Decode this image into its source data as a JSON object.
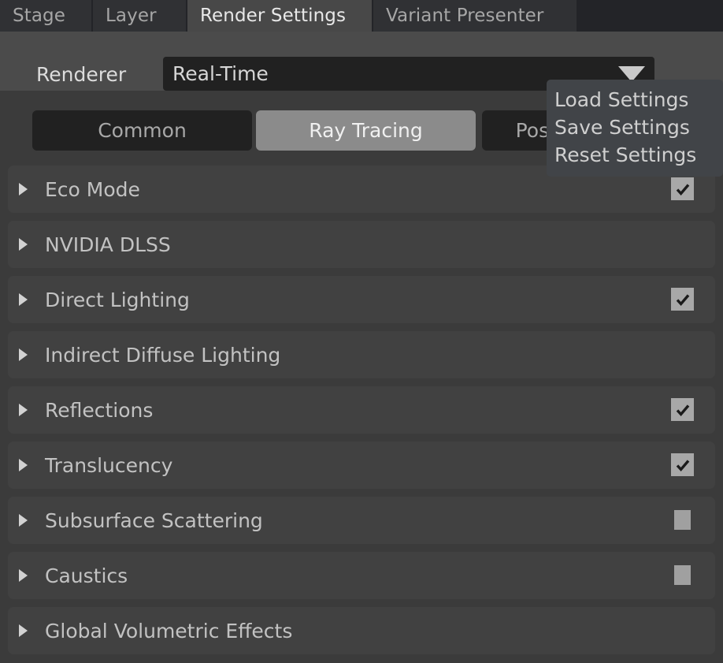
{
  "tabs": [
    {
      "label": "Stage",
      "active": false
    },
    {
      "label": "Layer",
      "active": false
    },
    {
      "label": "Render Settings",
      "active": true
    },
    {
      "label": "Variant Presenter",
      "active": false
    }
  ],
  "header": {
    "renderer_label": "Renderer",
    "renderer_value": "Real-Time",
    "renderer_placeholder": "Real-Time",
    "dropdown_icon": "chevron-down-icon",
    "menu_icon": "hamburger-menu-icon"
  },
  "subtabs": [
    {
      "label": "Common",
      "selected": false
    },
    {
      "label": "Ray Tracing",
      "selected": true
    },
    {
      "label": "Post Processing",
      "selected": false
    }
  ],
  "context_menu": {
    "visible": true,
    "items": [
      {
        "label": "Load Settings"
      },
      {
        "label": "Save Settings"
      },
      {
        "label": "Reset Settings"
      }
    ]
  },
  "rows": [
    {
      "label": "Eco Mode",
      "checkbox": "checked"
    },
    {
      "label": "NVIDIA DLSS",
      "checkbox": "none"
    },
    {
      "label": "Direct Lighting",
      "checkbox": "checked"
    },
    {
      "label": "Indirect Diffuse Lighting",
      "checkbox": "none"
    },
    {
      "label": "Reflections",
      "checkbox": "checked"
    },
    {
      "label": "Translucency",
      "checkbox": "checked"
    },
    {
      "label": "Subsurface Scattering",
      "checkbox": "unchecked"
    },
    {
      "label": "Caustics",
      "checkbox": "unchecked"
    },
    {
      "label": "Global Volumetric Effects",
      "checkbox": "none"
    }
  ],
  "colors": {
    "window_background": "#3b3b3b",
    "tabbar_background": "#232428",
    "tab_inactive": "#303134",
    "tab_active": "#484848",
    "header_background": "#4b4b4b",
    "combo_background": "#212121",
    "row_background": "#414141",
    "accent_selected": "#8b8b8b",
    "checkbox_fill": "#a8a8a8",
    "menu_background": "#414448",
    "text_primary": "#e8e8e8",
    "text_secondary": "#a6a6a6"
  }
}
